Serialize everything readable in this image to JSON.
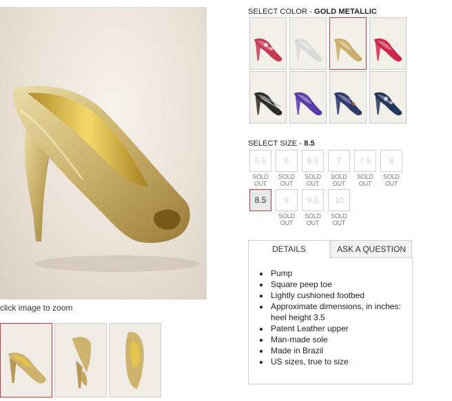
{
  "zoom_caption": "click image to zoom",
  "thumbnails": [
    {
      "name": "side view",
      "selected": true
    },
    {
      "name": "back view",
      "selected": false
    },
    {
      "name": "top view",
      "selected": false
    }
  ],
  "color": {
    "label": "SELECT COLOR -",
    "selected": "GOLD METALLIC",
    "swatches": [
      {
        "color": "#c23b52",
        "pattern": "floral",
        "selected": false
      },
      {
        "color": "#d9d9d9",
        "pattern": "solid",
        "selected": false
      },
      {
        "color": "#c8ae6a",
        "pattern": "solid",
        "selected": true
      },
      {
        "color": "#d0284a",
        "pattern": "solid",
        "selected": false
      },
      {
        "color": "#2b2b2b",
        "pattern": "snake",
        "selected": false
      },
      {
        "color": "#5a3aa8",
        "pattern": "solid",
        "selected": false
      },
      {
        "color": "#2e3a68",
        "pattern": "print",
        "selected": false
      },
      {
        "color": "#22365c",
        "pattern": "floral",
        "selected": false
      }
    ]
  },
  "size": {
    "label": "SELECT SIZE -",
    "selected": "8.5",
    "sold_out_label_1": "SOLD",
    "sold_out_label_2": "OUT",
    "options": [
      {
        "value": "5.5",
        "sold_out": true
      },
      {
        "value": "6",
        "sold_out": true
      },
      {
        "value": "6.5",
        "sold_out": true
      },
      {
        "value": "7",
        "sold_out": true
      },
      {
        "value": "7.5",
        "sold_out": true
      },
      {
        "value": "8",
        "sold_out": true
      },
      {
        "value": "8.5",
        "sold_out": false
      },
      {
        "value": "9",
        "sold_out": true
      },
      {
        "value": "9.5",
        "sold_out": true
      },
      {
        "value": "10",
        "sold_out": true
      }
    ]
  },
  "tabs": {
    "details": "DETAILS",
    "ask": "ASK A QUESTION"
  },
  "details": [
    "Pump",
    "Square peep toe",
    "Lightly cushioned footbed",
    "Approximate dimensions, in inches: heel height 3.5",
    "Patent Leather upper",
    "Man-made sole",
    "Made in Brazil",
    "US sizes, true to size"
  ],
  "colors": {
    "gold": "#cdb36e",
    "gold_light": "#e8d9a2",
    "gold_dark": "#9a7d38",
    "selected_border": "#b04040"
  }
}
